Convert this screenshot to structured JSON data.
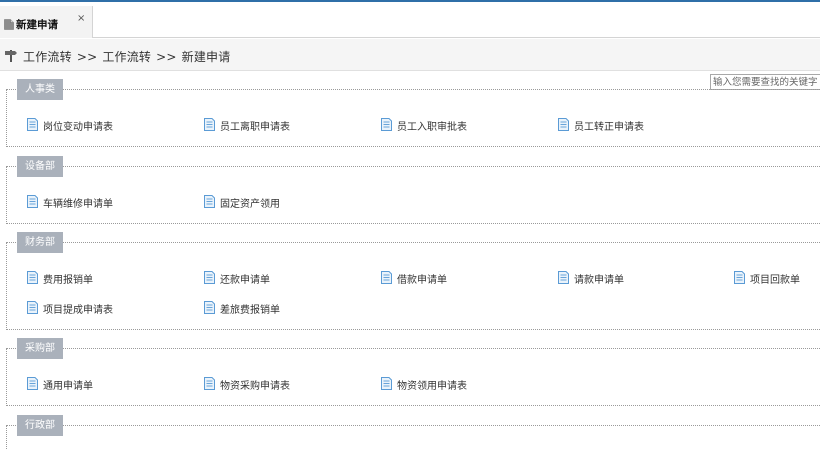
{
  "tab": {
    "label": "新建申请",
    "close": "×"
  },
  "breadcrumb": {
    "items": [
      "工作流转",
      "工作流转",
      "新建申请"
    ],
    "separator": ">>"
  },
  "search": {
    "placeholder": "输入您需要查找的关键字",
    "value": ""
  },
  "sections": [
    {
      "title": "人事类",
      "items": [
        "岗位变动申请表",
        "员工离职申请表",
        "员工入职审批表",
        "员工转正申请表"
      ]
    },
    {
      "title": "设备部",
      "items": [
        "车辆维修申请单",
        "固定资产领用"
      ]
    },
    {
      "title": "财务部",
      "items": [
        "费用报销单",
        "还款申请单",
        "借款申请单",
        "请款申请单",
        "项目回款单",
        "项目提成申请表",
        "差旅费报销单"
      ]
    },
    {
      "title": "采购部",
      "items": [
        "通用申请单",
        "物资采购申请表",
        "物资领用申请表"
      ]
    },
    {
      "title": "行政部",
      "items": []
    }
  ],
  "colors": {
    "accent": "#2f6fa8",
    "section_title_bg": "#aab1bb",
    "form_icon": "#5b9bd5"
  }
}
